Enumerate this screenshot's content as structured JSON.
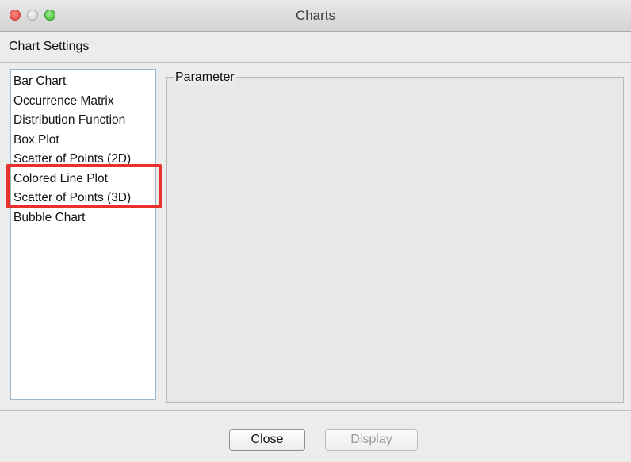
{
  "window": {
    "title": "Charts"
  },
  "settings_label": "Chart Settings",
  "chart_list": {
    "items": [
      "Bar Chart",
      "Occurrence Matrix",
      "Distribution Function",
      "Box Plot",
      "Scatter of Points (2D)",
      "Colored Line Plot",
      "Scatter of Points (3D)",
      "Bubble Chart"
    ],
    "highlighted": [
      "Colored Line Plot",
      "Scatter of Points (3D)"
    ]
  },
  "parameter_group": {
    "label": "Parameter"
  },
  "buttons": {
    "close": "Close",
    "display": "Display"
  },
  "colors": {
    "highlight": "#e8312a"
  }
}
